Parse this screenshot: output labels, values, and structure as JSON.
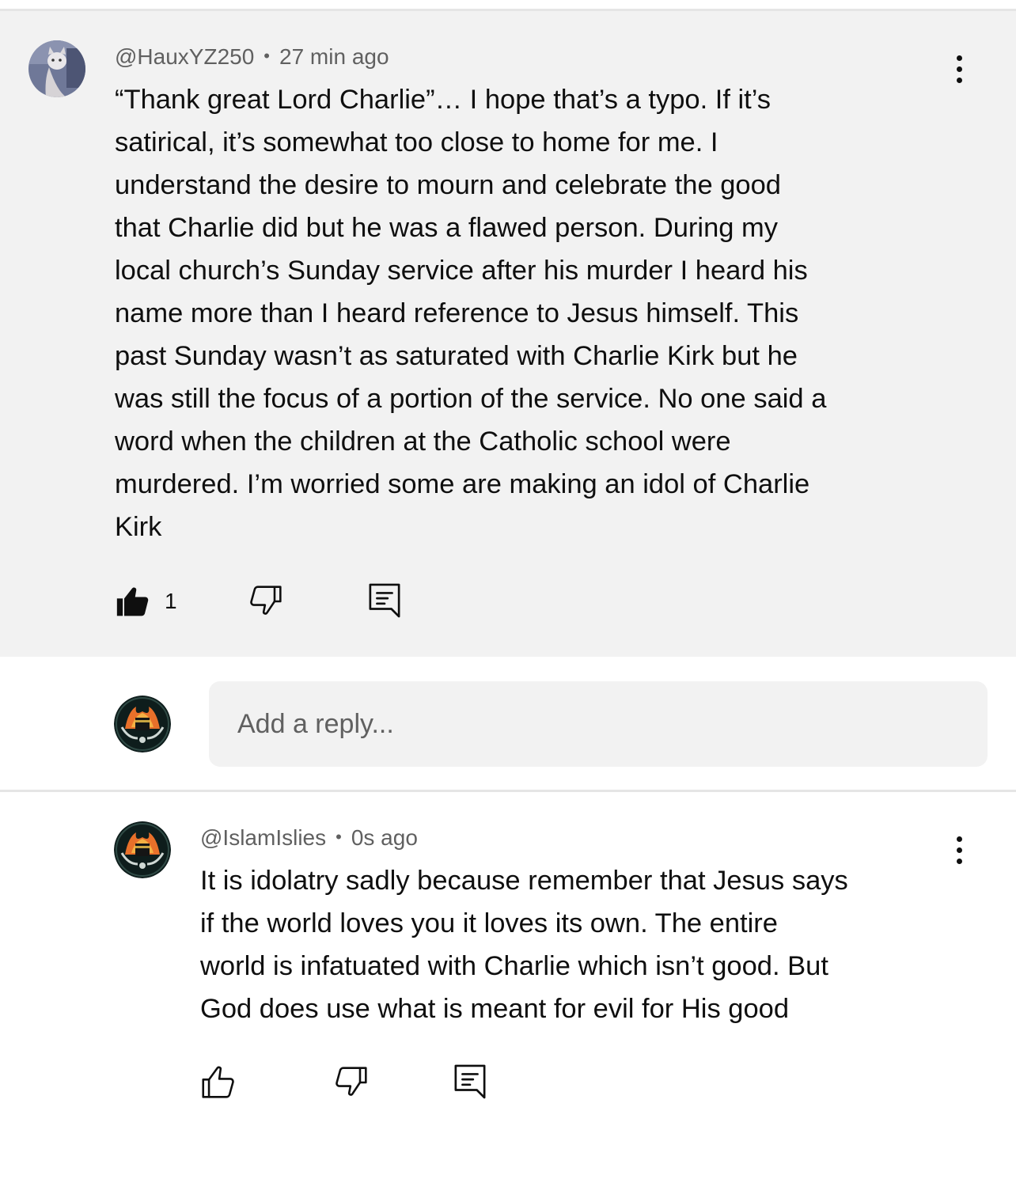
{
  "comment": {
    "handle": "@HauxYZ250",
    "separator": "•",
    "time": "27 min ago",
    "text": "“Thank great Lord Charlie”… I hope that’s a typo. If it’s\nsatirical, it’s somewhat too close to home for me. I\nunderstand the desire to mourn and celebrate the good\nthat Charlie did but he was a flawed person. During my\nlocal church’s Sunday service after his murder I heard his\nname more than I heard reference to Jesus himself. This\npast Sunday wasn’t as saturated with Charlie Kirk but he\nwas still the focus of a portion of the service. No one said a\nword when the children at the Catholic school were\nmurdered. I’m worried some are making an idol of Charlie\nKirk",
    "like_count": "1",
    "liked": true,
    "icons": {
      "avatar": "user-avatar-cat",
      "more": "kebab-menu-icon",
      "like": "thumbs-up-filled-icon",
      "dislike": "thumbs-down-outline-icon",
      "reply": "reply-comment-icon"
    }
  },
  "reply_box": {
    "placeholder": "Add a reply..."
  },
  "reply": {
    "handle": "@IslamIslies",
    "separator": "•",
    "time": "0s ago",
    "text": "It is idolatry sadly because remember that Jesus says\nif the world loves you it loves its own. The entire\nworld is infatuated with Charlie which isn’t good. But\nGod does use what is meant for evil for His good",
    "liked": false,
    "icons": {
      "avatar": "user-avatar-emblem",
      "more": "kebab-menu-icon",
      "like": "thumbs-up-outline-icon",
      "dislike": "thumbs-down-outline-icon",
      "reply": "reply-comment-icon"
    }
  },
  "colors": {
    "thread_background": "#f2f2f2",
    "text": "#0f0f0f",
    "meta": "#606060",
    "divider": "#e5e5e5"
  }
}
